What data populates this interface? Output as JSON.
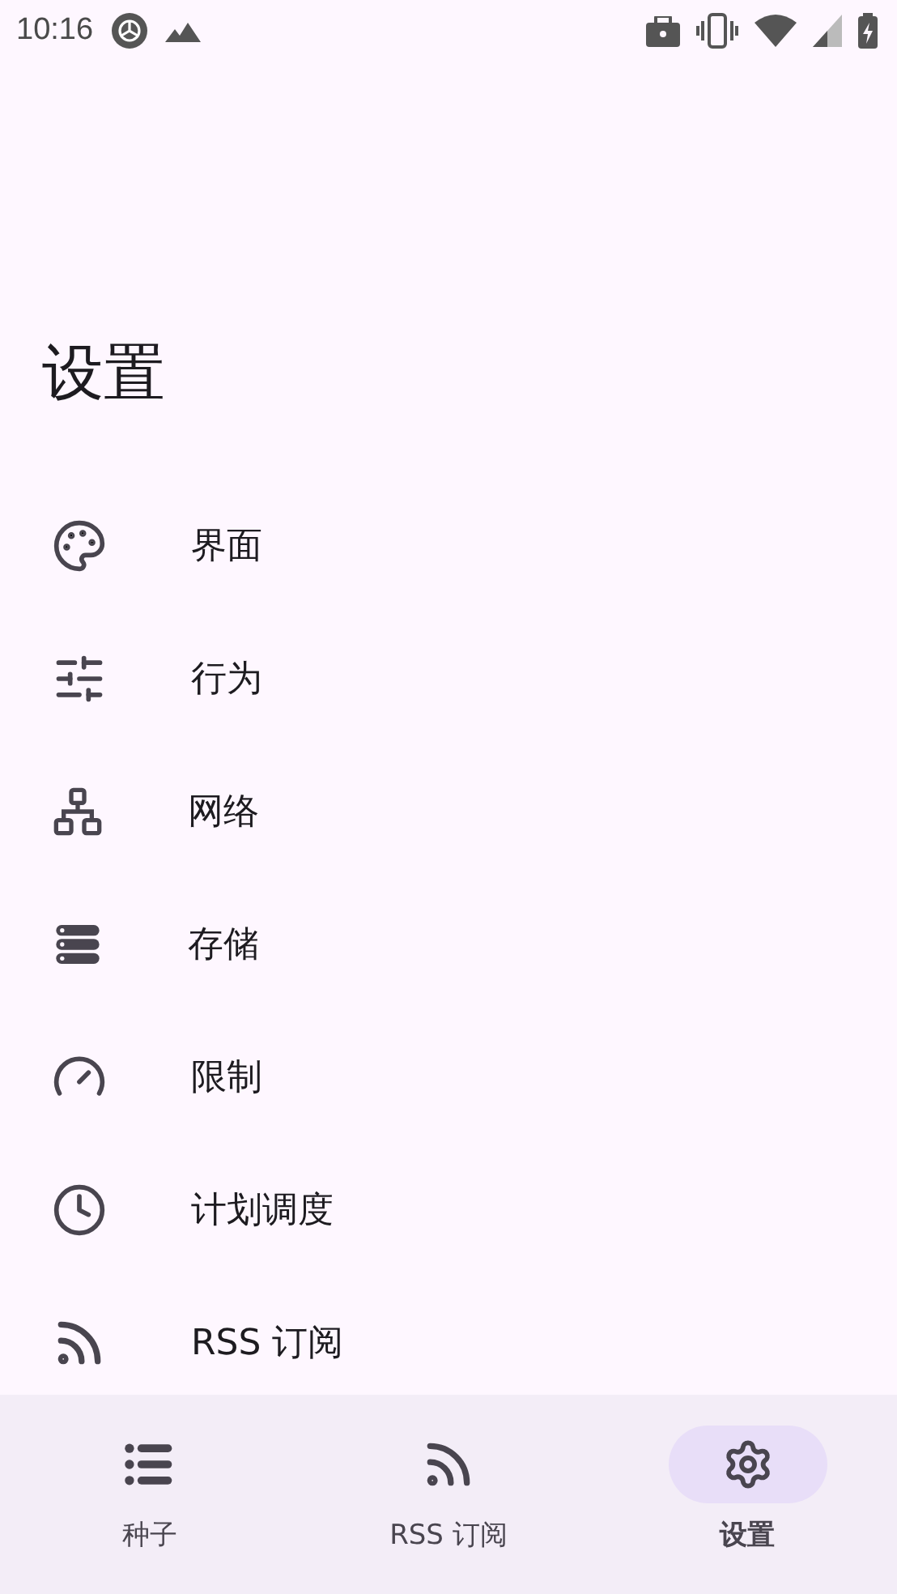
{
  "status_bar": {
    "time": "10:16"
  },
  "title": "设置",
  "settings_items": [
    {
      "label": "界面"
    },
    {
      "label": "行为"
    },
    {
      "label": "网络"
    },
    {
      "label": "存储"
    },
    {
      "label": "限制"
    },
    {
      "label": "计划调度"
    },
    {
      "label": "RSS 订阅"
    }
  ],
  "bottom_nav": [
    {
      "label": "种子",
      "selected": false
    },
    {
      "label": "RSS 订阅",
      "selected": false
    },
    {
      "label": "设置",
      "selected": true
    }
  ]
}
